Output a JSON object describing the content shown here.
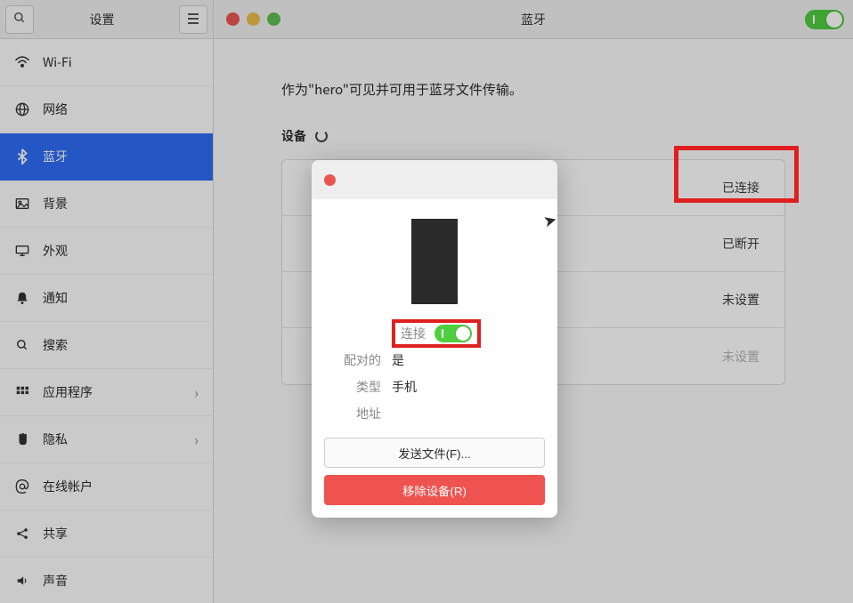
{
  "header": {
    "settings_label": "设置",
    "page_title": "蓝牙"
  },
  "sidebar": {
    "items": [
      {
        "label": "Wi-Fi"
      },
      {
        "label": "网络"
      },
      {
        "label": "蓝牙"
      },
      {
        "label": "背景"
      },
      {
        "label": "外观"
      },
      {
        "label": "通知"
      },
      {
        "label": "搜索"
      },
      {
        "label": "应用程序",
        "chev": true
      },
      {
        "label": "隐私",
        "chev": true
      },
      {
        "label": "在线帐户"
      },
      {
        "label": "共享"
      },
      {
        "label": "声音"
      }
    ]
  },
  "main": {
    "visibility_text": "作为\"hero\"可见并可用于蓝牙文件传输。",
    "devices_label": "设备",
    "device_status": [
      "已连接",
      "已断开",
      "未设置",
      "未设置"
    ]
  },
  "dialog": {
    "connect_label": "连接",
    "paired_label": "配对的",
    "paired_value": "是",
    "type_label": "类型",
    "type_value": "手机",
    "address_label": "地址",
    "address_value": "",
    "send_file": "发送文件(F)...",
    "remove_device": "移除设备(R)"
  }
}
